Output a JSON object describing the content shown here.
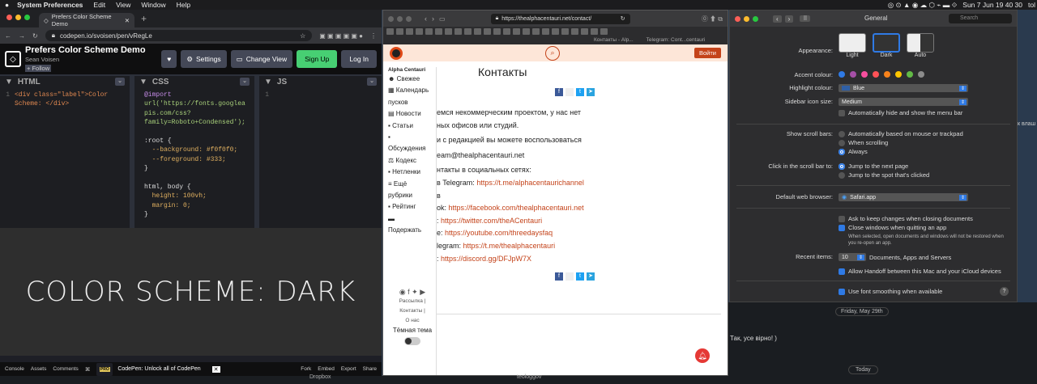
{
  "menubar": {
    "app": "System Preferences",
    "items": [
      "Edit",
      "View",
      "Window",
      "Help"
    ],
    "right": {
      "clock": "Sun 7 Jun  19 40 30",
      "user": "tol"
    }
  },
  "codepen": {
    "tab_title": "Prefers Color Scheme Demo",
    "url": "codepen.io/svoisen/pen/vRegLe",
    "pen_title": "Prefers Color Scheme Demo",
    "author": "Sean Voisen",
    "follow_label": "+ Follow",
    "buttons": {
      "settings": "Settings",
      "change_view": "Change View",
      "signup": "Sign Up",
      "login": "Log In"
    },
    "panels": {
      "html": "HTML",
      "css": "CSS",
      "js": "JS"
    },
    "html_code": [
      "<div class=\"label\">Color",
      "Scheme: </div>"
    ],
    "css_code": [
      "@import",
      "url('https://fonts.googlea",
      "pis.com/css?",
      "family=Roboto+Condensed');",
      "",
      ":root {",
      "  --background: #f0f0f0;",
      "  --foreground: #333;",
      "}",
      "",
      "html, body {",
      "  height: 100vh;",
      "  margin: 0;",
      "}"
    ],
    "preview_text": "COLOR SCHEME: DARK",
    "footer": [
      "Console",
      "Assets",
      "Comments",
      "⌘",
      "Fork",
      "Embed",
      "Export",
      "Share"
    ],
    "toast": "CodePen: Unlock all of CodePen"
  },
  "safari": {
    "url": "https://thealphacentauri.net/contact/",
    "tabs": [
      "Контакты - Alp...",
      "Telegram: Cont...centauri"
    ],
    "login_btn": "Войти",
    "logo_text": "Alpha Centauri",
    "page_title": "Контакты",
    "sidebar": [
      "Свежее",
      "Календарь",
      "пусков",
      "Новости",
      "Статьи",
      "",
      "Обсуждения",
      "Кодекс",
      "Нетленки",
      "Ещё",
      "рубрики",
      "Рейтинг",
      "",
      "Подержать"
    ],
    "sidebar_footer": {
      "links": "Рассылка | Контакты |",
      "about": "О нас",
      "theme": "Тёмная тема"
    },
    "lines": [
      {
        "t": "емся некоммерческим проектом, у нас нет"
      },
      {
        "t": "ных офисов или студий."
      },
      {
        "t": "и с редакцией вы можете воспользоваться"
      },
      {
        "t": "eam@thealphacentauri.net"
      },
      {
        "t": "нтакты в социальных сетях:"
      },
      {
        "t": "в Telegram: ",
        "l": "https://t.me/alphacentaurichannel"
      },
      {
        "t": "в"
      },
      {
        "t": "ok: ",
        "l": "https://facebook.com/thealphacentauri.net"
      },
      {
        "t": ": ",
        "l": "https://twitter.com/theACentauri"
      },
      {
        "t": "e: ",
        "l": "https://youtube.com/threedaysfaq"
      },
      {
        "t": "legram: ",
        "l": "https://t.me/thealphacentauri"
      },
      {
        "t": ": ",
        "l": "https://discord.gg/DFJpW7X"
      }
    ]
  },
  "sysprefs": {
    "title": "General",
    "search_placeholder": "Search",
    "appearance_label": "Appearance:",
    "appearance_opts": [
      "Light",
      "Dark",
      "Auto"
    ],
    "accent_label": "Accent colour:",
    "accent_colors": [
      "#2f7ae5",
      "#a550a7",
      "#f74f9e",
      "#ff5257",
      "#f7821b",
      "#ffc600",
      "#62ba46",
      "#8c8c8c"
    ],
    "highlight_label": "Highlight colour:",
    "highlight_value": "Blue",
    "icon_size_label": "Sidebar icon size:",
    "icon_size_value": "Medium",
    "auto_hide": "Automatically hide and show the menu bar",
    "scroll_label": "Show scroll bars:",
    "scroll_opts": [
      "Automatically based on mouse or trackpad",
      "When scrolling",
      "Always"
    ],
    "click_label": "Click in the scroll bar to:",
    "click_opts": [
      "Jump to the next page",
      "Jump to the spot that's clicked"
    ],
    "browser_label": "Default web browser:",
    "browser_value": "Safari.app",
    "ask_keep": "Ask to keep changes when closing documents",
    "close_windows": "Close windows when quitting an app",
    "close_note": "When selected, open documents and windows will not be restored when you re-open an app.",
    "recent_label": "Recent items:",
    "recent_value": "10",
    "recent_suffix": "Documents, Apps and Servers",
    "handoff": "Allow Handoff between this Mac and your iCloud devices",
    "font_smooth": "Use font smoothing when available"
  },
  "background": {
    "date_pill": "Friday, May 29th",
    "message": "Так, усе вірно! )",
    "today": "Today",
    "side_text": "к влаш",
    "taskbar": [
      "Dropbox",
      "teologgov"
    ]
  }
}
